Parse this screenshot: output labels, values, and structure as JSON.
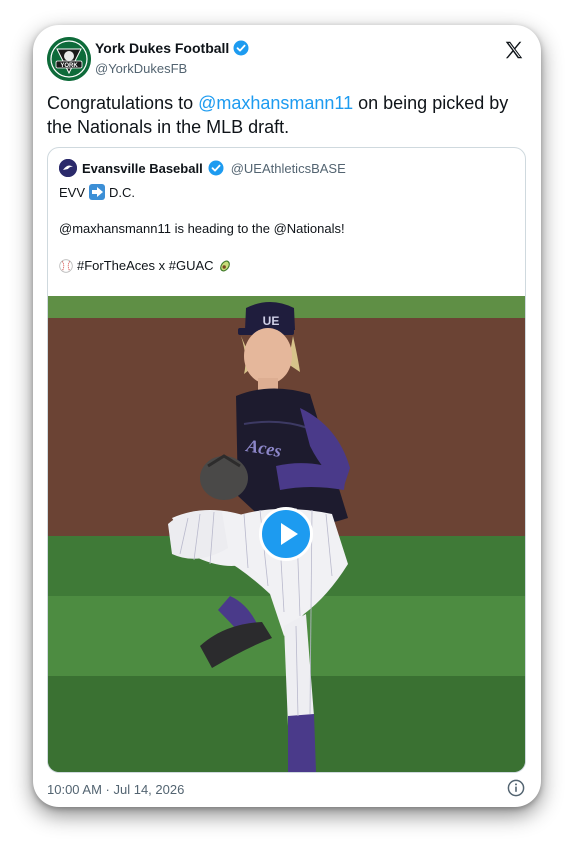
{
  "author": {
    "name": "York Dukes Football",
    "handle": "@YorkDukesFB",
    "avatar_text": "YORK",
    "verified": true
  },
  "platform_icon": "x-logo-icon",
  "tweet": {
    "prefix": "Congratulations to ",
    "mention": "@maxhansmann11",
    "suffix": " on being picked by the Nationals in the MLB draft."
  },
  "quote": {
    "name": "Evansville Baseball",
    "handle": "@UEAthleticsBASE",
    "line1_left": "EVV",
    "line1_right": "D.C.",
    "line2": "@maxhansmann11 is heading to the @Nationals!",
    "line3": "#ForTheAces x #GUAC",
    "media": {
      "description_icon": "play-button-icon",
      "cap_logo": "UE",
      "jersey_text": "Aces"
    }
  },
  "timestamp": "10:00 AM · Jul 14, 2026",
  "colors": {
    "link": "#1d9bf0",
    "verified": "#1d9bf0",
    "secondary_text": "#536471",
    "border": "#cfd9de"
  }
}
